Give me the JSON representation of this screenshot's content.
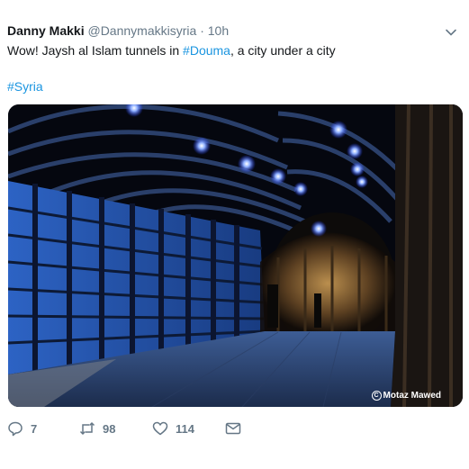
{
  "tweet": {
    "author_name": "Danny Makki",
    "author_handle": "@Dannymakkisyria",
    "separator": "·",
    "time": "10h",
    "text_before": "Wow! Jaysh al Islam tunnels in ",
    "text_link": "#Douma",
    "text_after": ", a city under a city",
    "hashtag": "#Syria",
    "photo_credit": "Motaz Mawed",
    "credit_symbol": "C"
  },
  "actions": {
    "reply_count": "7",
    "retweet_count": "98",
    "like_count": "114"
  },
  "colors": {
    "link": "#1b95e0",
    "muted": "#657786",
    "text": "#14171a",
    "tunnel_blue": "#2f6fd6",
    "light_glow": "#5f8cff"
  },
  "icons": [
    "chevron-down-icon",
    "reply-icon",
    "retweet-icon",
    "like-icon",
    "message-icon",
    "copyright-icon"
  ]
}
